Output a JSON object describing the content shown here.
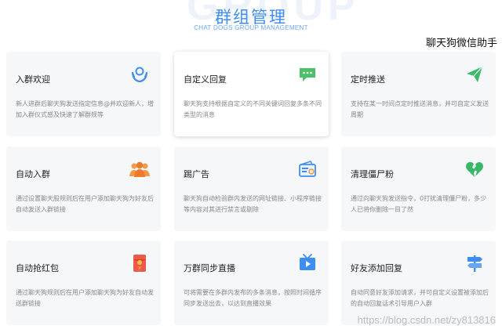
{
  "header": {
    "title": "群组管理",
    "subtitle": "CHAT DOGS GROUP MANAGEMENT",
    "watermark": "GROUP"
  },
  "corner_label": "聊天狗微信助手",
  "bottom_watermark": "https://blog.csdn.net/zy813816",
  "features": [
    {
      "title": "入群欢迎",
      "desc": "新人进群后聊天狗发送指定信息@并欢迎新人，增加入群仪式感及快速了解群规等",
      "icon": "welcome-hands-icon"
    },
    {
      "title": "自定义回复",
      "desc": "聊天狗支持根据自定义的不同关键词回复多条不同类型的消息",
      "icon": "chat-bubble-icon"
    },
    {
      "title": "定时推送",
      "desc": "支持在某一时间点定时推送消息，并可自定义发送周期",
      "icon": "paper-plane-icon"
    },
    {
      "title": "自动入群",
      "desc": "通过设置聊天股规则后在用户添加聊天狗为好友后自动发送入群链接",
      "icon": "group-people-icon"
    },
    {
      "title": "踢广告",
      "desc": "聊天狗自动检验群内发送的网址链接、小程序链接等内容对其进行禁言或剔除",
      "icon": "ad-card-icon"
    },
    {
      "title": "清理僵尸粉",
      "desc": "通过向聊天狗发送指令，0打扰清理僵尸粉，多少人已将你删除一目了然",
      "icon": "broken-heart-icon"
    },
    {
      "title": "自动抢红包",
      "desc": "通过聊天狗规则后在用户添加聊天狗为好友自动发送群链接",
      "icon": "red-packet-icon"
    },
    {
      "title": "万群同步直播",
      "desc": "可将需要在多群内发布的多条消息，按照时间循序同步发送出去，以达到直播效果",
      "icon": "tv-play-icon"
    },
    {
      "title": "好友添加回复",
      "desc": "自动同意好友添加请求，并可自定义设置被添加后的自动回复话术引导用户入群",
      "icon": "signpost-icon"
    }
  ],
  "colors": {
    "accent": "#3d8ef0",
    "card_bg": "#f6f7f9",
    "title_text": "#222222",
    "desc_text": "#888888"
  }
}
